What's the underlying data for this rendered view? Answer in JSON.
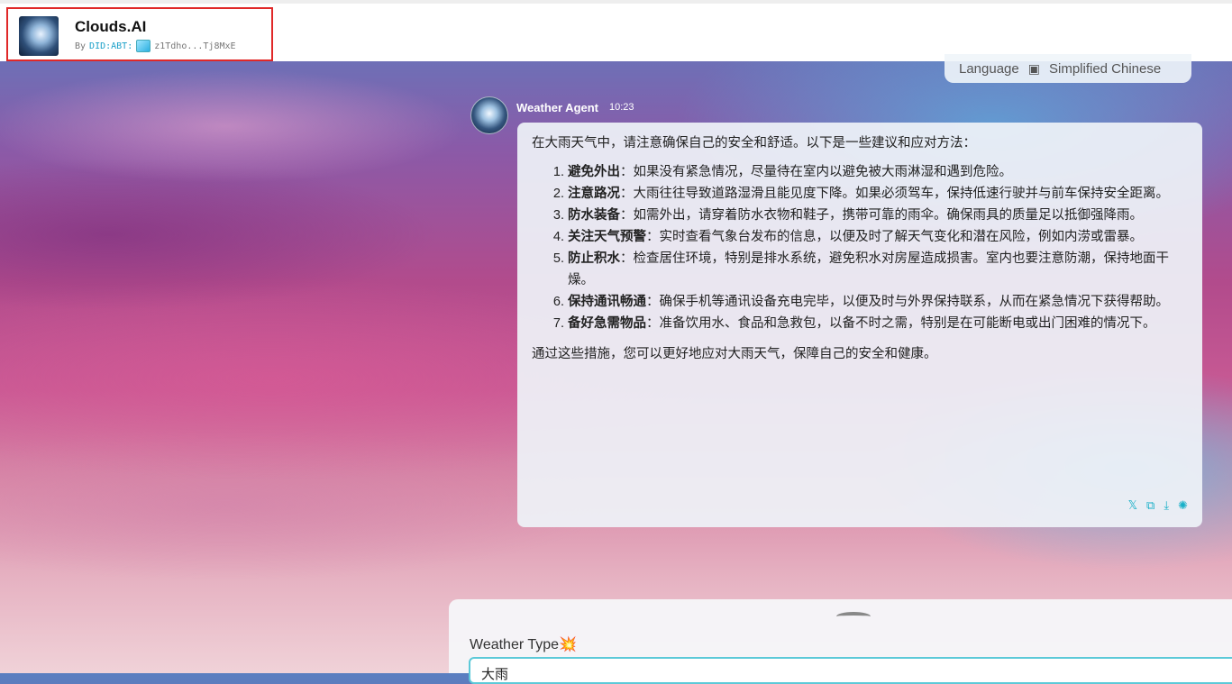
{
  "header": {
    "app_title": "Clouds.AI",
    "by_label": "By",
    "did_prefix": "DID:ABT:",
    "did_short": "z1Tdho...Tj8MxE"
  },
  "language_pill": {
    "label": "Language",
    "value": "Simplified Chinese"
  },
  "message": {
    "agent_name": "Weather Agent",
    "time": "10:23",
    "intro": "在大雨天气中，请注意确保自己的安全和舒适。以下是一些建议和应对方法：",
    "items": [
      {
        "title": "避免外出",
        "text": "：如果没有紧急情况，尽量待在室内以避免被大雨淋湿和遇到危险。"
      },
      {
        "title": "注意路况",
        "text": "：大雨往往导致道路湿滑且能见度下降。如果必须驾车，保持低速行驶并与前车保持安全距离。"
      },
      {
        "title": "防水装备",
        "text": "：如需外出，请穿着防水衣物和鞋子，携带可靠的雨伞。确保雨具的质量足以抵御强降雨。"
      },
      {
        "title": "关注天气预警",
        "text": "：实时查看气象台发布的信息，以便及时了解天气变化和潜在风险，例如内涝或雷暴。"
      },
      {
        "title": "防止积水",
        "text": "：检查居住环境，特别是排水系统，避免积水对房屋造成损害。室内也要注意防潮，保持地面干燥。"
      },
      {
        "title": "保持通讯畅通",
        "text": "：确保手机等通讯设备充电完毕，以便及时与外界保持联系，从而在紧急情况下获得帮助。"
      },
      {
        "title": "备好急需物品",
        "text": "：准备饮用水、食品和急救包，以备不时之需，特别是在可能断电或出门困难的情况下。"
      }
    ],
    "outro": "通过这些措施，您可以更好地应对大雨天气，保障自己的安全和健康。",
    "actions": [
      "x-share-icon",
      "copy-icon",
      "download-icon",
      "regenerate-icon"
    ]
  },
  "input_panel": {
    "field_label": "Weather Type",
    "field_emoji": "💥",
    "field_value": "大雨"
  }
}
